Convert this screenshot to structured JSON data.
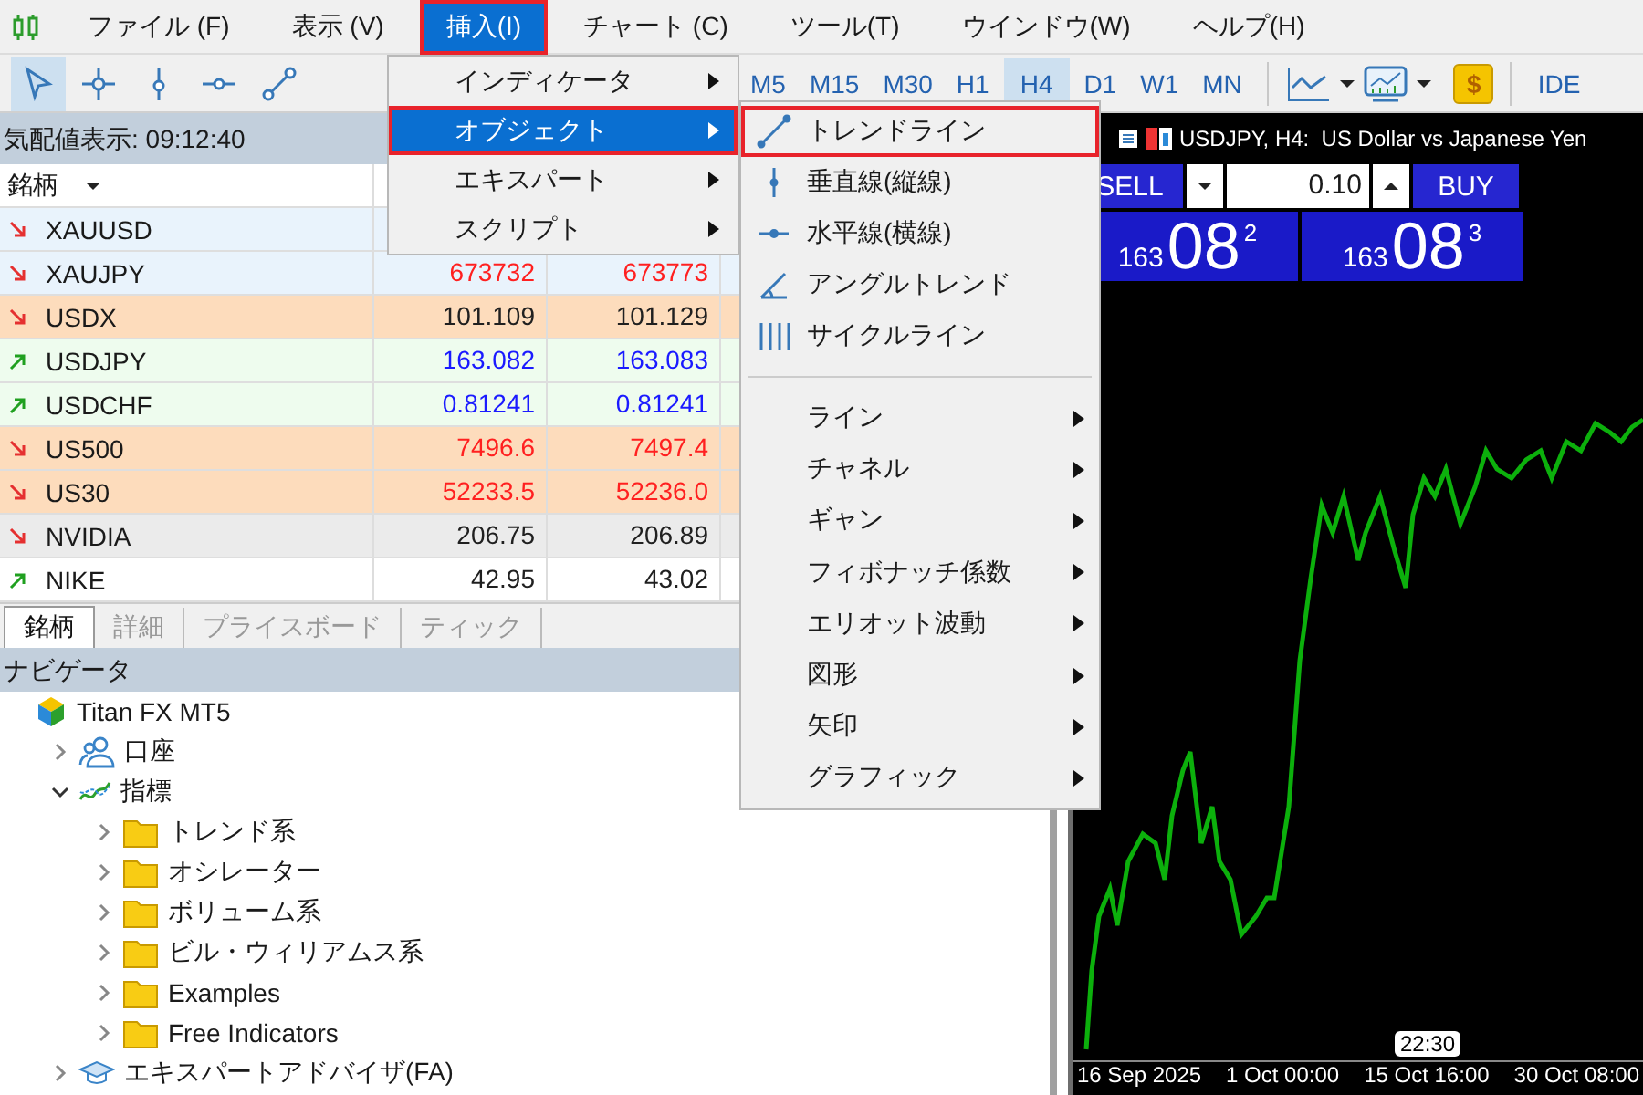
{
  "menubar": {
    "items": [
      {
        "label": "ファイル (F)",
        "selected": false
      },
      {
        "label": "表示 (V)",
        "selected": false
      },
      {
        "label": "挿入(I)",
        "selected": true
      },
      {
        "label": "チャート (C)",
        "selected": false
      },
      {
        "label": "ツール(T)",
        "selected": false
      },
      {
        "label": "ウインドウ(W)",
        "selected": false
      },
      {
        "label": "ヘルプ(H)",
        "selected": false
      }
    ]
  },
  "toolbar": {
    "tools": [
      {
        "kind": "cursor",
        "selected": true
      },
      {
        "kind": "crosshair",
        "selected": false
      },
      {
        "kind": "vline",
        "selected": false
      },
      {
        "kind": "hline",
        "selected": false
      },
      {
        "kind": "trendline",
        "selected": false
      }
    ],
    "timeframes": [
      {
        "label": "M5",
        "selected": false
      },
      {
        "label": "M15",
        "selected": false
      },
      {
        "label": "M30",
        "selected": false
      },
      {
        "label": "H1",
        "selected": false
      },
      {
        "label": "H4",
        "selected": true
      },
      {
        "label": "D1",
        "selected": false
      },
      {
        "label": "W1",
        "selected": false
      },
      {
        "label": "MN",
        "selected": false
      }
    ],
    "dollar": "$",
    "ide": "IDE"
  },
  "market_watch": {
    "title": "気配値表示: 09:12:40",
    "column": "銘柄",
    "rows": [
      {
        "symbol": "XAUUSD",
        "rising": false,
        "color": "#e9f3fc"
      },
      {
        "symbol": "XAUJPY",
        "rising": false,
        "color": "#e9f3fc",
        "prices": [
          {
            "text": "673732",
            "color": "#ff2020"
          },
          {
            "text": "673773",
            "color": "#ff2020"
          }
        ]
      },
      {
        "symbol": "USDX",
        "rising": false,
        "color": "#fddcbc",
        "prices": [
          {
            "text": "101.109",
            "color": "#202020"
          },
          {
            "text": "101.129",
            "color": "#202020"
          }
        ]
      },
      {
        "symbol": "USDJPY",
        "rising": true,
        "color": "#eefcee",
        "prices": [
          {
            "text": "163.082",
            "color": "#1a1aff"
          },
          {
            "text": "163.083",
            "color": "#1a1aff"
          }
        ]
      },
      {
        "symbol": "USDCHF",
        "rising": true,
        "color": "#eefcee",
        "prices": [
          {
            "text": "0.81241",
            "color": "#1a1aff"
          },
          {
            "text": "0.81241",
            "color": "#1a1aff"
          }
        ]
      },
      {
        "symbol": "US500",
        "rising": false,
        "color": "#fddcbc",
        "prices": [
          {
            "text": "7496.6",
            "color": "#ff2020"
          },
          {
            "text": "7497.4",
            "color": "#ff2020"
          }
        ]
      },
      {
        "symbol": "US30",
        "rising": false,
        "color": "#fddcbc",
        "prices": [
          {
            "text": "52233.5",
            "color": "#ff2020"
          },
          {
            "text": "52236.0",
            "color": "#ff2020"
          }
        ]
      },
      {
        "symbol": "NVIDIA",
        "rising": false,
        "color": "#ebebeb",
        "prices": [
          {
            "text": "206.75",
            "color": "#202020"
          },
          {
            "text": "206.89",
            "color": "#202020"
          }
        ]
      },
      {
        "symbol": "NIKE",
        "rising": true,
        "color": "#ffffff",
        "prices": [
          {
            "text": "42.95",
            "color": "#202020"
          },
          {
            "text": "43.02",
            "color": "#202020"
          }
        ]
      }
    ],
    "tabs": [
      {
        "label": "銘柄",
        "selected": true
      },
      {
        "label": "詳細",
        "selected": false
      },
      {
        "label": "プライスボード",
        "selected": false
      },
      {
        "label": "ティック",
        "selected": false
      }
    ]
  },
  "navigator": {
    "title": "ナビゲータ",
    "tree": [
      {
        "label": "Titan FX MT5",
        "kind": "broker",
        "children": [
          {
            "label": "口座",
            "kind": "accounts",
            "expanded": false
          },
          {
            "label": "指標",
            "kind": "indicators",
            "expanded": true,
            "children": [
              {
                "label": "トレンド系",
                "kind": "folder",
                "expanded": false
              },
              {
                "label": "オシレーター",
                "kind": "folder",
                "expanded": false
              },
              {
                "label": "ボリューム系",
                "kind": "folder",
                "expanded": false
              },
              {
                "label": "ビル・ウィリアムス系",
                "kind": "folder",
                "expanded": false
              },
              {
                "label": "Examples",
                "kind": "folder",
                "expanded": false
              },
              {
                "label": "Free Indicators",
                "kind": "folder",
                "expanded": false
              }
            ]
          },
          {
            "label": "エキスパートアドバイザ(FA)",
            "kind": "experts",
            "expanded": false
          }
        ]
      }
    ]
  },
  "insert_menu": {
    "items": [
      {
        "label": "インディケータ",
        "selected": false
      },
      {
        "label": "オブジェクト",
        "selected": true
      },
      {
        "label": "エキスパート",
        "selected": false
      },
      {
        "label": "スクリプト",
        "selected": false
      }
    ]
  },
  "object_menu": {
    "tools": [
      {
        "kind": "trendline",
        "label": "トレンドライン",
        "selected": true
      },
      {
        "kind": "vline",
        "label": "垂直線(縦線)",
        "selected": false
      },
      {
        "kind": "hline",
        "label": "水平線(横線)",
        "selected": false
      },
      {
        "kind": "angle",
        "label": "アングルトレンド",
        "selected": false
      },
      {
        "kind": "cycle",
        "label": "サイクルライン",
        "selected": false
      }
    ],
    "groups": [
      "ライン",
      "チャネル",
      "ギャン",
      "フィボナッチ係数",
      "エリオット波動",
      "図形",
      "矢印",
      "グラフィック"
    ]
  },
  "chart": {
    "title": "USDJPY, H4:  US Dollar vs Japanese Yen",
    "trade": {
      "sell": "SELL",
      "buy": "BUY",
      "volume": "0.10",
      "bid": {
        "big": "163",
        "main": "08",
        "small": "2"
      },
      "ask": {
        "big": "163",
        "main": "08",
        "small": "3"
      }
    },
    "time_labels": [
      "16 Sep 2025",
      "1 Oct 00:00",
      "15 Oct 16:00",
      "30 Oct 08:00"
    ],
    "cursor_time": "22:30"
  }
}
